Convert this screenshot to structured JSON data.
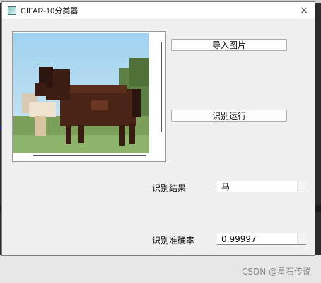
{
  "window": {
    "title": "CIFAR-10分类器",
    "close_icon": "×"
  },
  "buttons": {
    "import_label": "导入图片",
    "run_label": "识别运行"
  },
  "result": {
    "label": "识别结果",
    "value": "马"
  },
  "accuracy": {
    "label": "识别准确率",
    "value": "0.99997"
  },
  "watermark": "CSDN @星石传说",
  "image": {
    "subject": "horse"
  }
}
